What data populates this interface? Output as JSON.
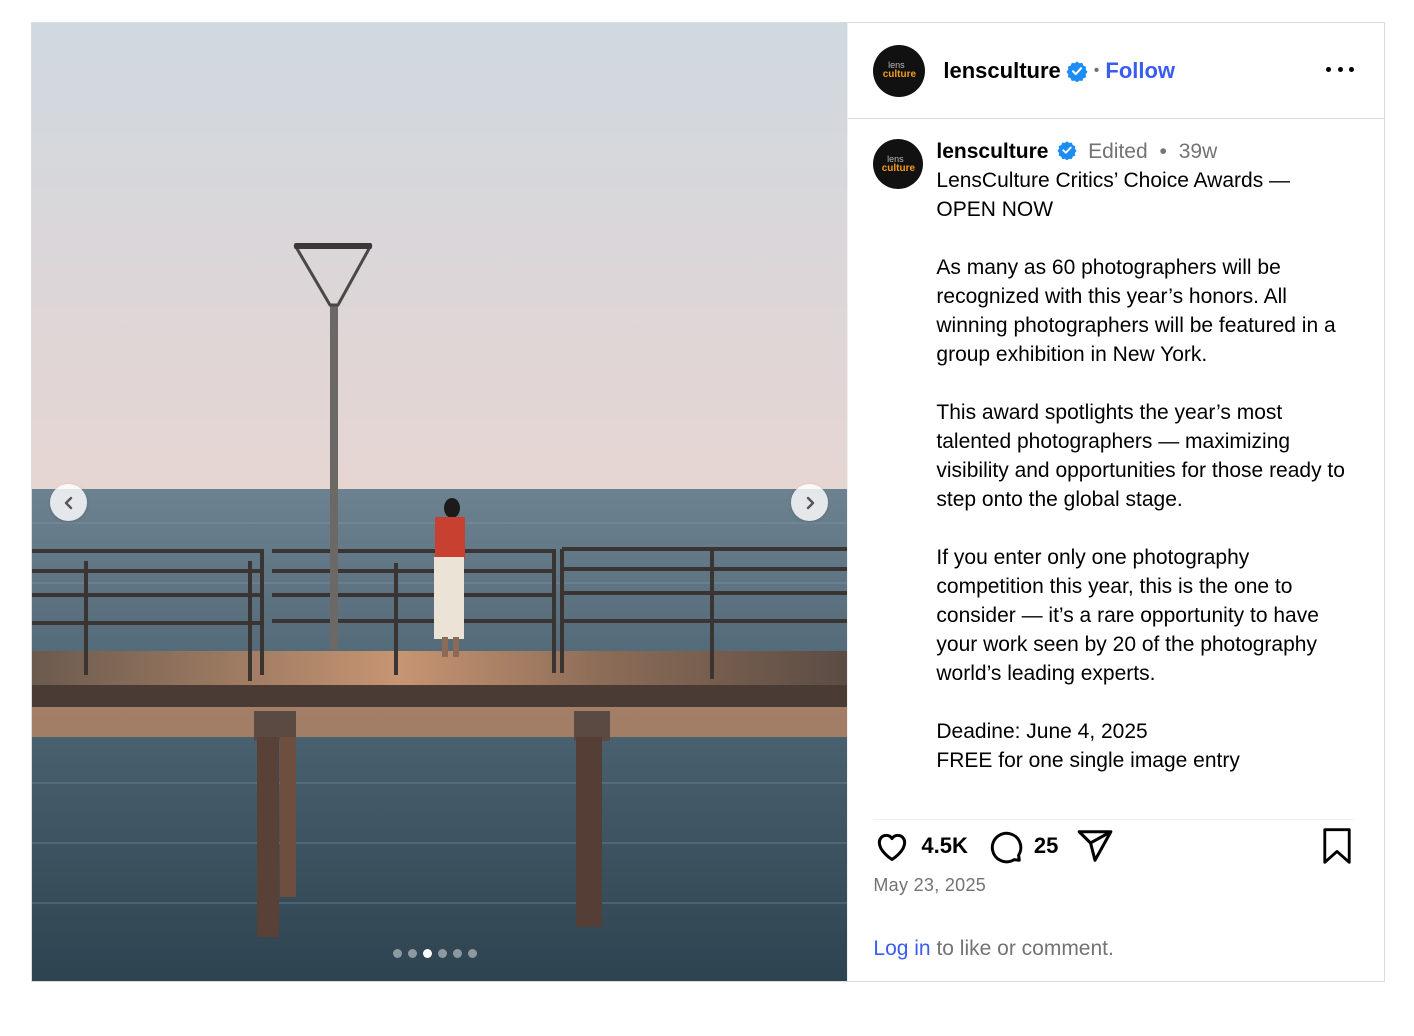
{
  "post": {
    "carousel": {
      "slide_count": 6,
      "active_index": 2
    },
    "header": {
      "avatar_text_top": "lens",
      "avatar_text_bottom": "culture",
      "username": "lensculture",
      "separator": "•",
      "follow_label": "Follow"
    },
    "caption": {
      "username": "lensculture",
      "edited_label": "Edited",
      "separator": "•",
      "time_ago": "39w",
      "text": "LensCulture Critics’ Choice Awards — OPEN NOW\n\nAs many as 60 photographers will be recognized with this year’s honors. All winning photographers will be featured in a group exhibition in New York.\n\nThis award spotlights the year’s most talented photographers — maximizing visibility and opportunities for those ready to step onto the global stage.\n\nIf you enter only one photography competition this year, this is the one to consider — it’s a rare opportunity to have your work seen by 20 of the photography world’s leading experts.\n\nDeadine: June 4, 2025\nFREE for one single image entry"
    },
    "actions": {
      "likes": "4.5K",
      "comments": "25"
    },
    "date": "May 23, 2025",
    "login": {
      "link": "Log in",
      "rest": " to like or comment."
    }
  },
  "colors": {
    "accent": "#3b5cf0",
    "verified": "#1d8df5",
    "muted": "#737373",
    "avatar_bg": "#111111",
    "avatar_logo": "#f39a1e"
  }
}
